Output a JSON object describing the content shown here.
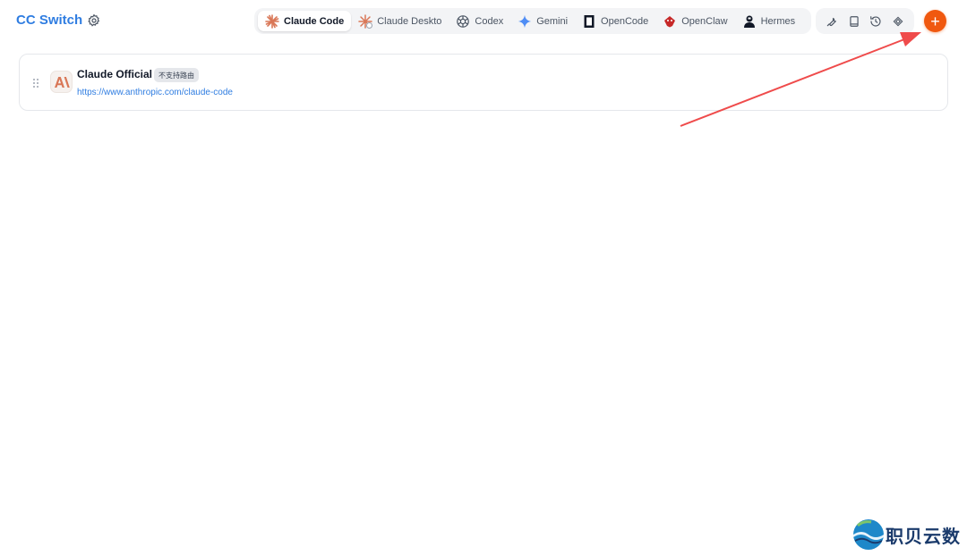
{
  "app": {
    "title": "CC Switch"
  },
  "header": {
    "settings_icon": "gear-icon",
    "tabs": [
      {
        "label": "Claude Code",
        "icon": "claude-sunburst-icon",
        "active": true
      },
      {
        "label": "Claude Deskto",
        "icon": "claude-desktop-icon",
        "active": false
      },
      {
        "label": "Codex",
        "icon": "openai-knot-icon",
        "active": false
      },
      {
        "label": "Gemini",
        "icon": "gemini-sparkle-icon",
        "active": false
      },
      {
        "label": "OpenCode",
        "icon": "opencode-square-icon",
        "active": false
      },
      {
        "label": "OpenClaw",
        "icon": "openclaw-crab-icon",
        "active": false
      },
      {
        "label": "Hermes",
        "icon": "hermes-figure-icon",
        "active": false
      }
    ],
    "tools": [
      {
        "name": "wrench-icon"
      },
      {
        "name": "book-icon"
      },
      {
        "name": "history-icon"
      },
      {
        "name": "fingerprint-icon"
      }
    ],
    "add_button": {
      "label": "+",
      "color": "#f0580f"
    }
  },
  "providers": [
    {
      "name": "Claude Official",
      "badge": "不支持路由",
      "url": "https://www.anthropic.com/claude-code",
      "logo_icon": "anthropic-logo-icon",
      "logo_text": "A\\"
    }
  ],
  "watermark": {
    "text": "职贝云数"
  },
  "colors": {
    "accent": "#2f7de1",
    "add": "#f0580f",
    "arrow": "#ef4b4b",
    "claude": "#d97757"
  }
}
